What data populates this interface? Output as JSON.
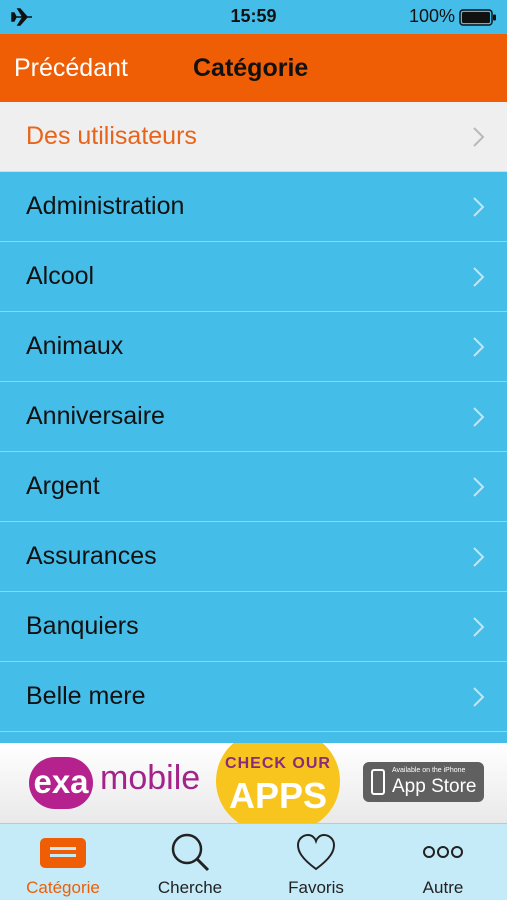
{
  "status_bar": {
    "time": "15:59",
    "battery": "100%",
    "icons": [
      "airplane-icon",
      "battery-icon"
    ]
  },
  "nav": {
    "back_label": "Précédant",
    "title": "Catégorie"
  },
  "list": {
    "header_item": "Des utilisateurs",
    "items": [
      "Administration",
      "Alcool",
      "Animaux",
      "Anniversaire",
      "Argent",
      "Assurances",
      "Banquiers",
      "Belle mere"
    ]
  },
  "ad": {
    "logo_exa": "exa",
    "logo_mobile": "mobile",
    "check_text": "CHECK OUR",
    "apps_text": "APPS",
    "appstore_small": "Available on the iPhone",
    "appstore_big": "App Store"
  },
  "tabs": [
    {
      "label": "Catégorie",
      "icon": "category-icon",
      "active": true
    },
    {
      "label": "Cherche",
      "icon": "search-icon",
      "active": false
    },
    {
      "label": "Favoris",
      "icon": "heart-icon",
      "active": false
    },
    {
      "label": "Autre",
      "icon": "more-icon",
      "active": false
    }
  ],
  "colors": {
    "background": "#45bde9",
    "nav_bar": "#ef5d04",
    "header_text": "#e8641a",
    "tab_bar": "#c5ebf8"
  }
}
